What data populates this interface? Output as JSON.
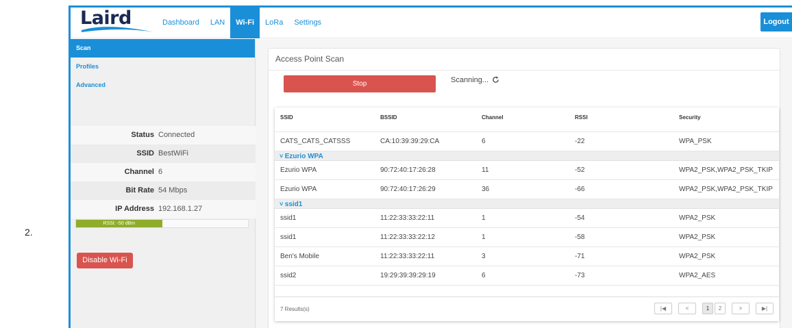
{
  "page": {
    "list_number": "2."
  },
  "brand": {
    "logo": "Laird",
    "accent": "#1a8fd8",
    "danger": "#d9534f",
    "signal": "#8fac2b"
  },
  "nav": {
    "items": [
      {
        "label": "Dashboard",
        "active": false
      },
      {
        "label": "LAN",
        "active": false
      },
      {
        "label": "Wi-Fi",
        "active": true
      },
      {
        "label": "LoRa",
        "active": false
      },
      {
        "label": "Settings",
        "active": false
      }
    ],
    "logout": "Logout"
  },
  "sidebar": {
    "items": [
      {
        "label": "Scan",
        "active": true
      },
      {
        "label": "Profiles",
        "active": false
      },
      {
        "label": "Advanced",
        "active": false
      }
    ],
    "status": [
      {
        "label": "Status",
        "value": "Connected"
      },
      {
        "label": "SSID",
        "value": "BestWiFi"
      },
      {
        "label": "Channel",
        "value": "6"
      },
      {
        "label": "Bit Rate",
        "value": "54 Mbps"
      },
      {
        "label": "IP Address",
        "value": "192.168.1.27"
      }
    ],
    "rssi": {
      "label": "RSSI: -50 dBm",
      "fill_fraction": 0.5
    },
    "disable_button": "Disable Wi-Fi"
  },
  "scan": {
    "title": "Access Point Scan",
    "stop_button": "Stop",
    "scanning_text": "Scanning...",
    "columns": [
      "SSID",
      "BSSID",
      "Channel",
      "RSSI",
      "Security"
    ],
    "rows": [
      {
        "type": "row",
        "ssid": "CATS_CATS_CATSSS",
        "bssid": "CA:10:39:39:29:CA",
        "channel": "6",
        "rssi": "-22",
        "security": "WPA_PSK"
      },
      {
        "type": "group",
        "label": "Ezurio WPA"
      },
      {
        "type": "row",
        "ssid": "Ezurio WPA",
        "bssid": "90:72:40:17:26:28",
        "channel": "11",
        "rssi": "-52",
        "security": "WPA2_PSK,WPA2_PSK_TKIP"
      },
      {
        "type": "row",
        "ssid": "Ezurio WPA",
        "bssid": "90:72:40:17:26:29",
        "channel": "36",
        "rssi": "-66",
        "security": "WPA2_PSK,WPA2_PSK_TKIP"
      },
      {
        "type": "group",
        "label": "ssid1"
      },
      {
        "type": "row",
        "ssid": "ssid1",
        "bssid": "11:22:33:33:22:11",
        "channel": "1",
        "rssi": "-54",
        "security": "WPA2_PSK"
      },
      {
        "type": "row",
        "ssid": "ssid1",
        "bssid": "11:22:33:33:22:12",
        "channel": "1",
        "rssi": "-58",
        "security": "WPA2_PSK"
      },
      {
        "type": "row",
        "ssid": "Ben's Mobile",
        "bssid": "11:22:33:33:22:11",
        "channel": "3",
        "rssi": "-71",
        "security": "WPA2_PSK"
      },
      {
        "type": "row",
        "ssid": "ssid2",
        "bssid": "19:29:39:39:29:19",
        "channel": "6",
        "rssi": "-73",
        "security": "WPA2_AES"
      }
    ],
    "results": "7 Results(s)",
    "pager": {
      "first": "|◀",
      "prev": "<",
      "pages": [
        "1",
        "2"
      ],
      "current": "1",
      "next": ">",
      "last": "▶|"
    }
  }
}
